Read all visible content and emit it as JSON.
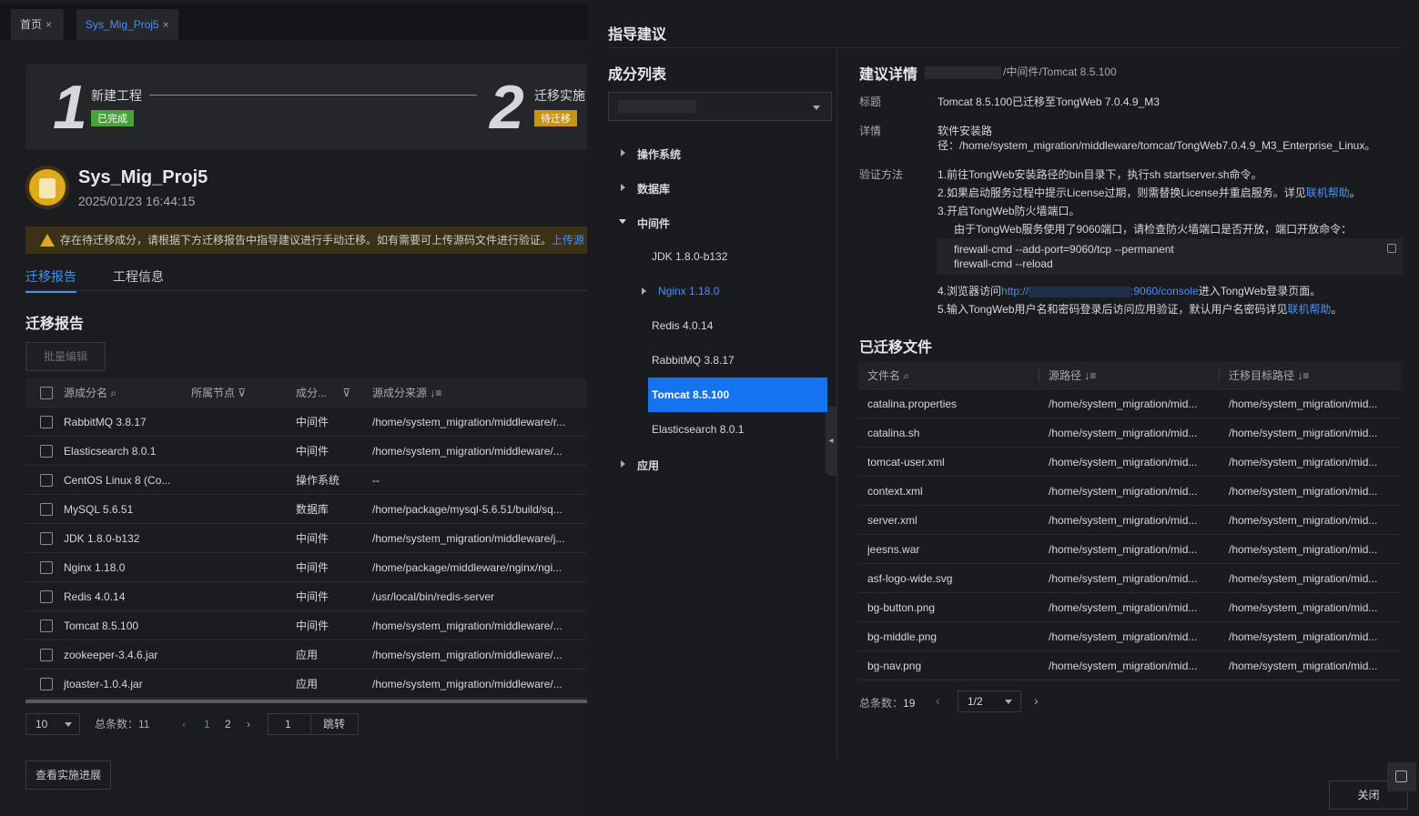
{
  "tabs": [
    {
      "label": "首页",
      "close": "×"
    },
    {
      "label": "Sys_Mig_Proj5",
      "close": "×"
    }
  ],
  "steps": [
    {
      "num": "1",
      "label": "新建工程",
      "status": "已完成",
      "status_color": "#4aa13b"
    },
    {
      "num": "2",
      "label": "迁移实施",
      "status": "待迁移",
      "status_color": "#c89512"
    }
  ],
  "project": {
    "name": "Sys_Mig_Proj5",
    "time": "2025/01/23 16:44:15"
  },
  "warning": {
    "text": "存在待迁移成分，请根据下方迁移报告中指导建议进行手动迁移。如有需要可上传源码文件进行验证。",
    "link": "上传源"
  },
  "subtabs": [
    "迁移报告",
    "工程信息"
  ],
  "report": {
    "title": "迁移报告",
    "batch_edit": "批量编辑",
    "columns": [
      "源成分名",
      "所属节点",
      "成分...",
      "源成分来源"
    ],
    "rows": [
      {
        "name": "RabbitMQ 3.8.17",
        "type": "中间件",
        "source": "/home/system_migration/middleware/r..."
      },
      {
        "name": "Elasticsearch 8.0.1",
        "type": "中间件",
        "source": "/home/system_migration/middleware/..."
      },
      {
        "name": "CentOS Linux 8 (Co...",
        "type": "操作系统",
        "source": "--"
      },
      {
        "name": "MySQL 5.6.51",
        "type": "数据库",
        "source": "/home/package/mysql-5.6.51/build/sq..."
      },
      {
        "name": "JDK 1.8.0-b132",
        "type": "中间件",
        "source": "/home/system_migration/middleware/j..."
      },
      {
        "name": "Nginx 1.18.0",
        "type": "中间件",
        "source": "/home/package/middleware/nginx/ngi..."
      },
      {
        "name": "Redis 4.0.14",
        "type": "中间件",
        "source": "/usr/local/bin/redis-server"
      },
      {
        "name": "Tomcat 8.5.100",
        "type": "中间件",
        "source": "/home/system_migration/middleware/..."
      },
      {
        "name": "zookeeper-3.4.6.jar",
        "type": "应用",
        "source": "/home/system_migration/middleware/..."
      },
      {
        "name": "jtoaster-1.0.4.jar",
        "type": "应用",
        "source": "/home/system_migration/middleware/..."
      }
    ],
    "pager": {
      "page_size": "10",
      "total_label": "总条数：",
      "total": "11",
      "pages": [
        "1",
        "2"
      ],
      "jump_value": "1",
      "jump_label": "跳转"
    },
    "progress_button": "查看实施进展"
  },
  "drawer": {
    "title": "指导建议",
    "components_title": "成分列表",
    "tree": {
      "os": "操作系统",
      "db": "数据库",
      "mw": "中间件",
      "jdk": "JDK 1.8.0-b132",
      "nginx": "Nginx 1.18.0",
      "redis": "Redis 4.0.14",
      "rabbit": "RabbitMQ 3.8.17",
      "tomcat": "Tomcat 8.5.100",
      "es": "Elasticsearch 8.0.1",
      "app": "应用"
    },
    "detail": {
      "title": "建议详情",
      "path": "/中间件/Tomcat 8.5.100",
      "title_label": "标题",
      "title_value": "Tomcat 8.5.100已迁移至TongWeb 7.0.4.9_M3",
      "detail_label": "详情",
      "detail_line1": "软件安装路",
      "detail_line2": "径：/home/system_migration/middleware/tomcat/TongWeb7.0.4.9_M3_Enterprise_Linux。",
      "verify_label": "验证方法",
      "step1": "1.前往TongWeb安装路径的bin目录下，执行sh startserver.sh命令。",
      "step2a": "2.如果启动服务过程中提示License过期，则需替换License并重启服务。详见",
      "step2_link": "联机帮助",
      "step2b": "。",
      "step3": "3.开启TongWeb防火墙端口。",
      "step3_note": "由于TongWeb服务使用了9060端口，请检查防火墙端口是否开放，端口开放命令：",
      "cmd1": "firewall-cmd --add-port=9060/tcp --permanent",
      "cmd2": "firewall-cmd --reload",
      "step4a": "4.浏览器访问",
      "step4_link1": "http://",
      "step4_link2": ":9060/console",
      "step4b": "进入TongWeb登录页面。",
      "step5a": "5.输入TongWeb用户名和密码登录后访问应用验证，默认用户名密码详见",
      "step5_link": "联机帮助",
      "step5b": "。"
    },
    "files": {
      "title": "已迁移文件",
      "columns": [
        "文件名",
        "源路径",
        "迁移目标路径"
      ],
      "rows": [
        {
          "name": "catalina.properties",
          "src": "/home/system_migration/mid...",
          "dst": "/home/system_migration/mid..."
        },
        {
          "name": "catalina.sh",
          "src": "/home/system_migration/mid...",
          "dst": "/home/system_migration/mid..."
        },
        {
          "name": "tomcat-user.xml",
          "src": "/home/system_migration/mid...",
          "dst": "/home/system_migration/mid..."
        },
        {
          "name": "context.xml",
          "src": "/home/system_migration/mid...",
          "dst": "/home/system_migration/mid..."
        },
        {
          "name": "server.xml",
          "src": "/home/system_migration/mid...",
          "dst": "/home/system_migration/mid..."
        },
        {
          "name": "jeesns.war",
          "src": "/home/system_migration/mid...",
          "dst": "/home/system_migration/mid..."
        },
        {
          "name": "asf-logo-wide.svg",
          "src": "/home/system_migration/mid...",
          "dst": "/home/system_migration/mid..."
        },
        {
          "name": "bg-button.png",
          "src": "/home/system_migration/mid...",
          "dst": "/home/system_migration/mid..."
        },
        {
          "name": "bg-middle.png",
          "src": "/home/system_migration/mid...",
          "dst": "/home/system_migration/mid..."
        },
        {
          "name": "bg-nav.png",
          "src": "/home/system_migration/mid...",
          "dst": "/home/system_migration/mid..."
        }
      ],
      "total_label": "总条数：",
      "total": "19",
      "page": "1/2"
    },
    "close": "关闭"
  }
}
